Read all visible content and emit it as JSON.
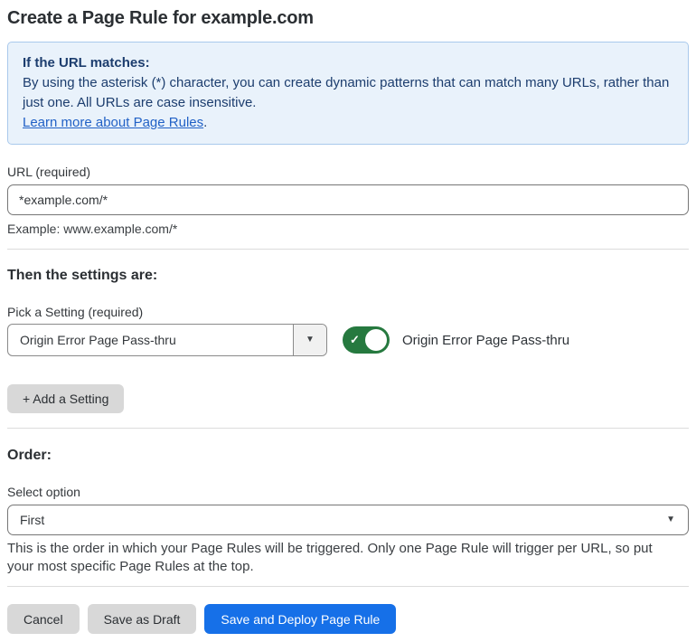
{
  "page": {
    "title": "Create a Page Rule for example.com"
  },
  "info_box": {
    "heading": "If the URL matches:",
    "body": "By using the asterisk (*) character, you can create dynamic patterns that can match many URLs, rather than just one. All URLs are case insensitive.",
    "link_text": "Learn more about Page Rules",
    "link_suffix": "."
  },
  "url_field": {
    "label": "URL (required)",
    "value": "*example.com/*",
    "example": "Example: www.example.com/*"
  },
  "settings_section": {
    "heading": "Then the settings are:",
    "picker_label": "Pick a Setting (required)",
    "selected_setting": "Origin Error Page Pass-thru",
    "toggle_label": "Origin Error Page Pass-thru",
    "toggle_state": "on",
    "add_setting_label": "+ Add a Setting"
  },
  "order_section": {
    "heading": "Order:",
    "select_label": "Select option",
    "selected_option": "First",
    "help_text": "This is the order in which your Page Rules will be triggered. Only one Page Rule will trigger per URL, so put your most specific Page Rules at the top."
  },
  "footer": {
    "cancel_label": "Cancel",
    "save_draft_label": "Save as Draft",
    "save_deploy_label": "Save and Deploy Page Rule"
  },
  "icons": {
    "chevron_down": "▼",
    "toggle_check": "✓"
  },
  "colors": {
    "accent_blue": "#1670E8",
    "toggle_green": "#26793F",
    "info_box_bg": "#E9F2FB",
    "info_box_border": "#A9C9EC",
    "info_box_text": "#1C3D6E",
    "link_blue": "#2161C6",
    "button_gray": "#D8D8D8"
  }
}
